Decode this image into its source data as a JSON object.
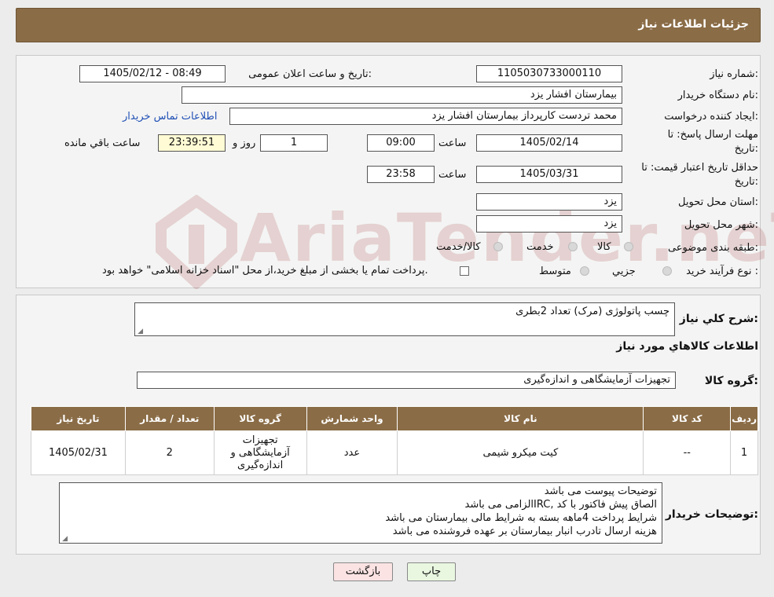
{
  "header": {
    "title": "جزئیات اطلاعات نیاز"
  },
  "info": {
    "need_number_label": "شماره نیاز:",
    "need_number": "1105030733000110",
    "announce_label": "تاریخ و ساعت اعلان عمومی:",
    "announce_value": "1405/02/12 - 08:49",
    "buyer_org_label": "نام دستگاه خریدار:",
    "buyer_org": "بیمارستان افشار یزد",
    "creator_label": "ایجاد کننده درخواست:",
    "creator": "محمد تردست کارپرداز بیمارستان افشار یزد",
    "contact_link": "اطلاعات تماس خریدار",
    "deadline_label_1": "مهلت ارسال پاسخ: تا",
    "deadline_label_2": "تاریخ:",
    "deadline_date": "1405/02/14",
    "time_label": "ساعت",
    "deadline_time": "09:00",
    "days_value": "1",
    "days_label": "روز و",
    "remaining_time": "23:39:51",
    "remaining_label": "ساعت باقي مانده",
    "validity_label_1": "حداقل تاریخ اعتبار قیمت: تا",
    "validity_label_2": "تاریخ:",
    "validity_date": "1405/03/31",
    "validity_time_label": "ساعت",
    "validity_time": "23:58",
    "province_label": "استان محل تحویل:",
    "province": "یزد",
    "city_label": "شهر محل تحویل:",
    "city": "یزد",
    "category_label": "طبقه بندی موضوعی:",
    "category_options": [
      "کالا",
      "خدمت",
      "کالا/خدمت"
    ],
    "purchase_type_label": "نوع فرآیند خرید :",
    "purchase_options": [
      "جزيي",
      "متوسط"
    ],
    "purchase_note": "پرداخت تمام یا بخشی از مبلغ خرید،از محل \"اسناد خزانه اسلامی\" خواهد بود."
  },
  "watermark": {
    "text": "AriaTender.neT"
  },
  "details": {
    "summary_label": "شرح کلي نياز:",
    "summary": "چسب پاتولوژی (مرک) تعداد 2بطری",
    "goods_info_title": "اطلاعات کالاهاي مورد نياز",
    "goods_group_label": "گروه کالا:",
    "goods_group": "تجهیزات آزمایشگاهی و اندازه‌گیری"
  },
  "table": {
    "headers": [
      "ردیف",
      "کد کالا",
      "نام کالا",
      "واحد شمارش",
      "گروه کالا",
      "تعداد / مقدار",
      "تاریخ نیاز"
    ],
    "rows": [
      [
        "1",
        "--",
        "کیت میکرو شیمی",
        "عدد",
        "تجهیزات آزمایشگاهی و اندازه‌گیری",
        "2",
        "1405/02/31"
      ]
    ]
  },
  "buyer_notes": {
    "label": "توضیحات خریدار:",
    "lines": [
      "توضیحات پیوست می باشد",
      "الصاق پیش فاکتور با کد  ,IRCالزامی می باشد",
      "شرایط پرداخت  4ماهه بسته به شرایط مالی بیمارستان می باشد",
      "هزینه ارسال تادرب انبار بیمارستان بر عهده فروشنده می باشد"
    ]
  },
  "buttons": {
    "print": "چاپ",
    "back": "بازگشت"
  },
  "colors": {
    "header_bg": "#8a6c46",
    "back_button_bg": "#fbe3e3",
    "print_button_bg": "#e9f7e0"
  }
}
